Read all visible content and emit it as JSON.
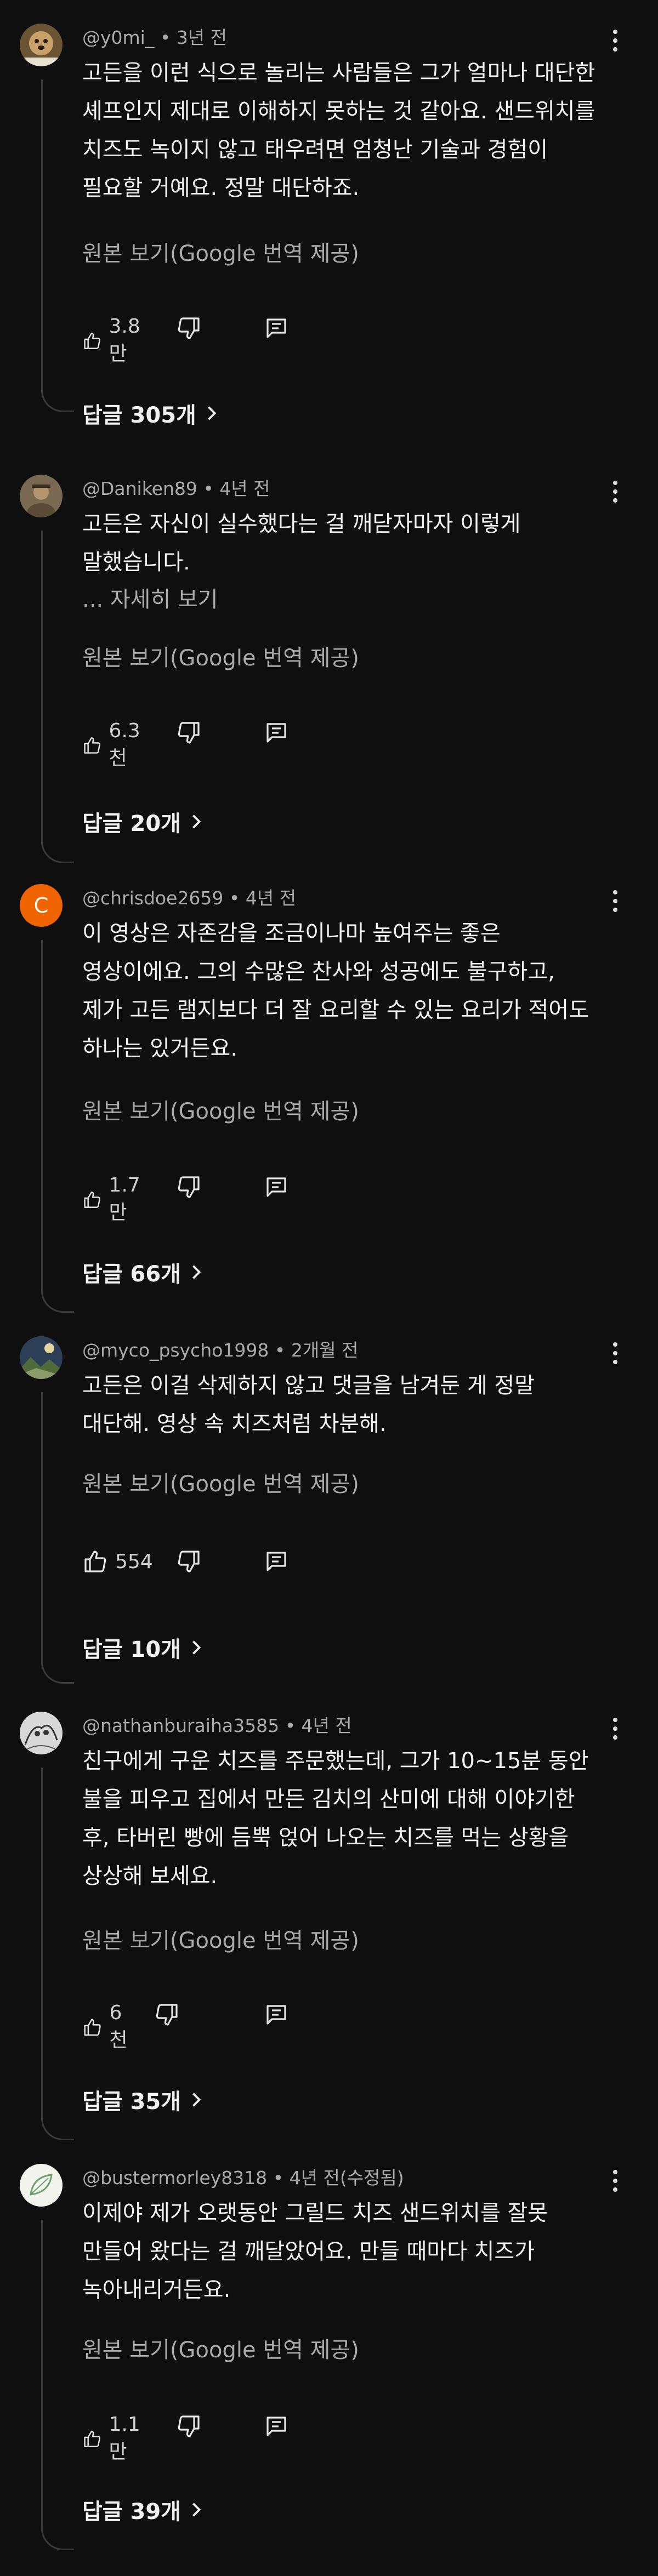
{
  "colors": {
    "background": "#0f0f0f",
    "text": "#f1f1f1",
    "muted": "#aaaaaa",
    "line": "#3a3a3a",
    "avatar_c": "#f06400"
  },
  "comments": [
    {
      "author": "@y0mi_",
      "time": "3년 전",
      "lines": [
        "고든을 이런 식으로 놀리는 사람들은 그가 얼마나 대단한",
        "셰프인지 제대로 이해하지 못하는 것 같아요. 샌드위치를",
        "치즈도 녹이지 않고 태우려면 엄청난 기술과 경험이",
        "필요할 거예요. 정말 대단하죠."
      ],
      "more": "",
      "translate": "원본 보기(Google 번역 제공)",
      "likes": "3.8만",
      "replies": "답글 305개",
      "avatar_icon": "dog-avatar-icon"
    },
    {
      "author": "@Daniken89",
      "time": "4년 전",
      "lines": [
        "고든은 자신이 실수했다는 걸 깨닫자마자 이렇게",
        "말했습니다."
      ],
      "more": "... 자세히 보기",
      "translate": "원본 보기(Google 번역 제공)",
      "likes": "6.3천",
      "replies": "답글 20개",
      "avatar_icon": "person-avatar-icon"
    },
    {
      "author": "@chrisdoe2659",
      "time": "4년 전",
      "lines": [
        "이 영상은 자존감을 조금이나마 높여주는 좋은",
        "영상이에요. 그의 수많은 찬사와 성공에도 불구하고,",
        "제가 고든 램지보다 더 잘 요리할 수 있는 요리가 적어도",
        "하나는 있거든요."
      ],
      "more": "",
      "translate": "원본 보기(Google 번역 제공)",
      "likes": "1.7만",
      "replies": "답글 66개",
      "avatar_letter": "C"
    },
    {
      "author": "@myco_psycho1998",
      "time": "2개월 전",
      "lines": [
        "고든은 이걸 삭제하지 않고 댓글을 남겨둔 게 정말",
        "대단해. 영상 속 치즈처럼 차분해."
      ],
      "more": "",
      "translate": "원본 보기(Google 번역 제공)",
      "likes": "554",
      "replies": "답글 10개",
      "avatar_icon": "landscape-avatar-icon"
    },
    {
      "author": "@nathanburaiha3585",
      "time": "4년 전",
      "lines": [
        "친구에게 구운 치즈를 주문했는데, 그가 10~15분 동안",
        "불을 피우고 집에서 만든 김치의 산미에 대해 이야기한",
        "후, 타버린 빵에 듬뿍 얹어 나오는 치즈를 먹는 상황을",
        "상상해 보세요."
      ],
      "more": "",
      "translate": "원본 보기(Google 번역 제공)",
      "likes": "6천",
      "replies": "답글 35개",
      "avatar_icon": "sketch-avatar-icon"
    },
    {
      "author": "@bustermorley8318",
      "time": "4년 전(수정됨)",
      "lines": [
        "이제야 제가 오랫동안 그릴드 치즈 샌드위치를 잘못",
        "만들어 왔다는 걸 깨달았어요. 만들 때마다 치즈가",
        "녹아내리거든요."
      ],
      "more": "",
      "translate": "원본 보기(Google 번역 제공)",
      "likes": "1.1만",
      "replies": "답글 39개",
      "avatar_icon": "leaf-avatar-icon"
    }
  ]
}
